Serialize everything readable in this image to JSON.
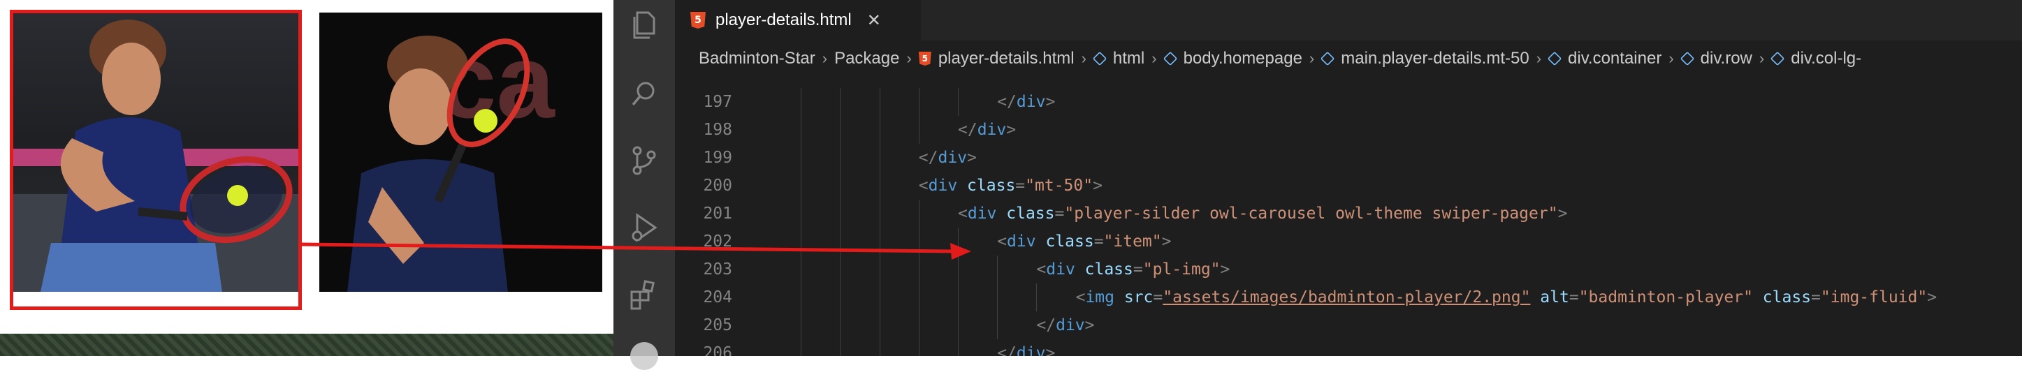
{
  "preview": {
    "photo_1_alt": "badminton-player",
    "photo_2_alt": "badminton-player"
  },
  "editor": {
    "tab": {
      "label": "player-details.html",
      "close": "✕",
      "icon": "html5-icon"
    },
    "breadcrumb": [
      {
        "label": "Badminton-Star",
        "icon": null
      },
      {
        "label": "Package",
        "icon": null
      },
      {
        "label": "player-details.html",
        "icon": "html5-icon"
      },
      {
        "label": "html",
        "icon": "symbol-icon"
      },
      {
        "label": "body.homepage",
        "icon": "symbol-icon"
      },
      {
        "label": "main.player-details.mt-50",
        "icon": "symbol-icon"
      },
      {
        "label": "div.container",
        "icon": "symbol-icon"
      },
      {
        "label": "div.row",
        "icon": "symbol-icon"
      },
      {
        "label": "div.col-lg-",
        "icon": "symbol-icon"
      }
    ],
    "activity_icons": [
      "explorer-icon",
      "search-icon",
      "source-control-icon",
      "run-debug-icon",
      "extensions-icon",
      "account-icon"
    ],
    "code_lines": [
      {
        "num": "197",
        "indent": 6,
        "parts": [
          [
            "t",
            "</"
          ],
          [
            "tag",
            "div"
          ],
          [
            "t",
            ">"
          ]
        ]
      },
      {
        "num": "198",
        "indent": 5,
        "parts": [
          [
            "t",
            "</"
          ],
          [
            "tag",
            "div"
          ],
          [
            "t",
            ">"
          ]
        ]
      },
      {
        "num": "199",
        "indent": 4,
        "parts": [
          [
            "t",
            "</"
          ],
          [
            "tag",
            "div"
          ],
          [
            "t",
            ">"
          ]
        ]
      },
      {
        "num": "200",
        "indent": 4,
        "parts": [
          [
            "t",
            "<"
          ],
          [
            "tag",
            "div"
          ],
          [
            "attr",
            " class"
          ],
          [
            "t",
            "="
          ],
          [
            "val",
            "\"mt-50\""
          ],
          [
            "t",
            ">"
          ]
        ]
      },
      {
        "num": "201",
        "indent": 5,
        "parts": [
          [
            "t",
            "<"
          ],
          [
            "tag",
            "div"
          ],
          [
            "attr",
            " class"
          ],
          [
            "t",
            "="
          ],
          [
            "val",
            "\"player-silder owl-carousel owl-theme swiper-pager\""
          ],
          [
            "t",
            ">"
          ]
        ]
      },
      {
        "num": "202",
        "indent": 6,
        "parts": [
          [
            "t",
            "<"
          ],
          [
            "tag",
            "div"
          ],
          [
            "attr",
            " class"
          ],
          [
            "t",
            "="
          ],
          [
            "val",
            "\"item\""
          ],
          [
            "t",
            ">"
          ]
        ]
      },
      {
        "num": "203",
        "indent": 7,
        "parts": [
          [
            "t",
            "<"
          ],
          [
            "tag",
            "div"
          ],
          [
            "attr",
            " class"
          ],
          [
            "t",
            "="
          ],
          [
            "val",
            "\"pl-img\""
          ],
          [
            "t",
            ">"
          ]
        ]
      },
      {
        "num": "204",
        "indent": 8,
        "parts": [
          [
            "t",
            "<"
          ],
          [
            "tag",
            "img"
          ],
          [
            "attr",
            " src"
          ],
          [
            "t",
            "="
          ],
          [
            "link",
            "\"assets/images/badminton-player/2.png\""
          ],
          [
            "attr",
            " alt"
          ],
          [
            "t",
            "="
          ],
          [
            "val",
            "\"badminton-player\""
          ],
          [
            "attr",
            " class"
          ],
          [
            "t",
            "="
          ],
          [
            "val",
            "\"img-fluid\""
          ],
          [
            "t",
            ">"
          ]
        ]
      },
      {
        "num": "205",
        "indent": 7,
        "parts": [
          [
            "t",
            "</"
          ],
          [
            "tag",
            "div"
          ],
          [
            "t",
            ">"
          ]
        ]
      },
      {
        "num": "206",
        "indent": 6,
        "parts": [
          [
            "t",
            "</"
          ],
          [
            "tag",
            "div"
          ],
          [
            "t",
            ">"
          ]
        ]
      }
    ]
  },
  "colors": {
    "annotation_red": "#e21b1b",
    "editor_bg": "#1e1e1e",
    "activity_bar": "#333333"
  }
}
